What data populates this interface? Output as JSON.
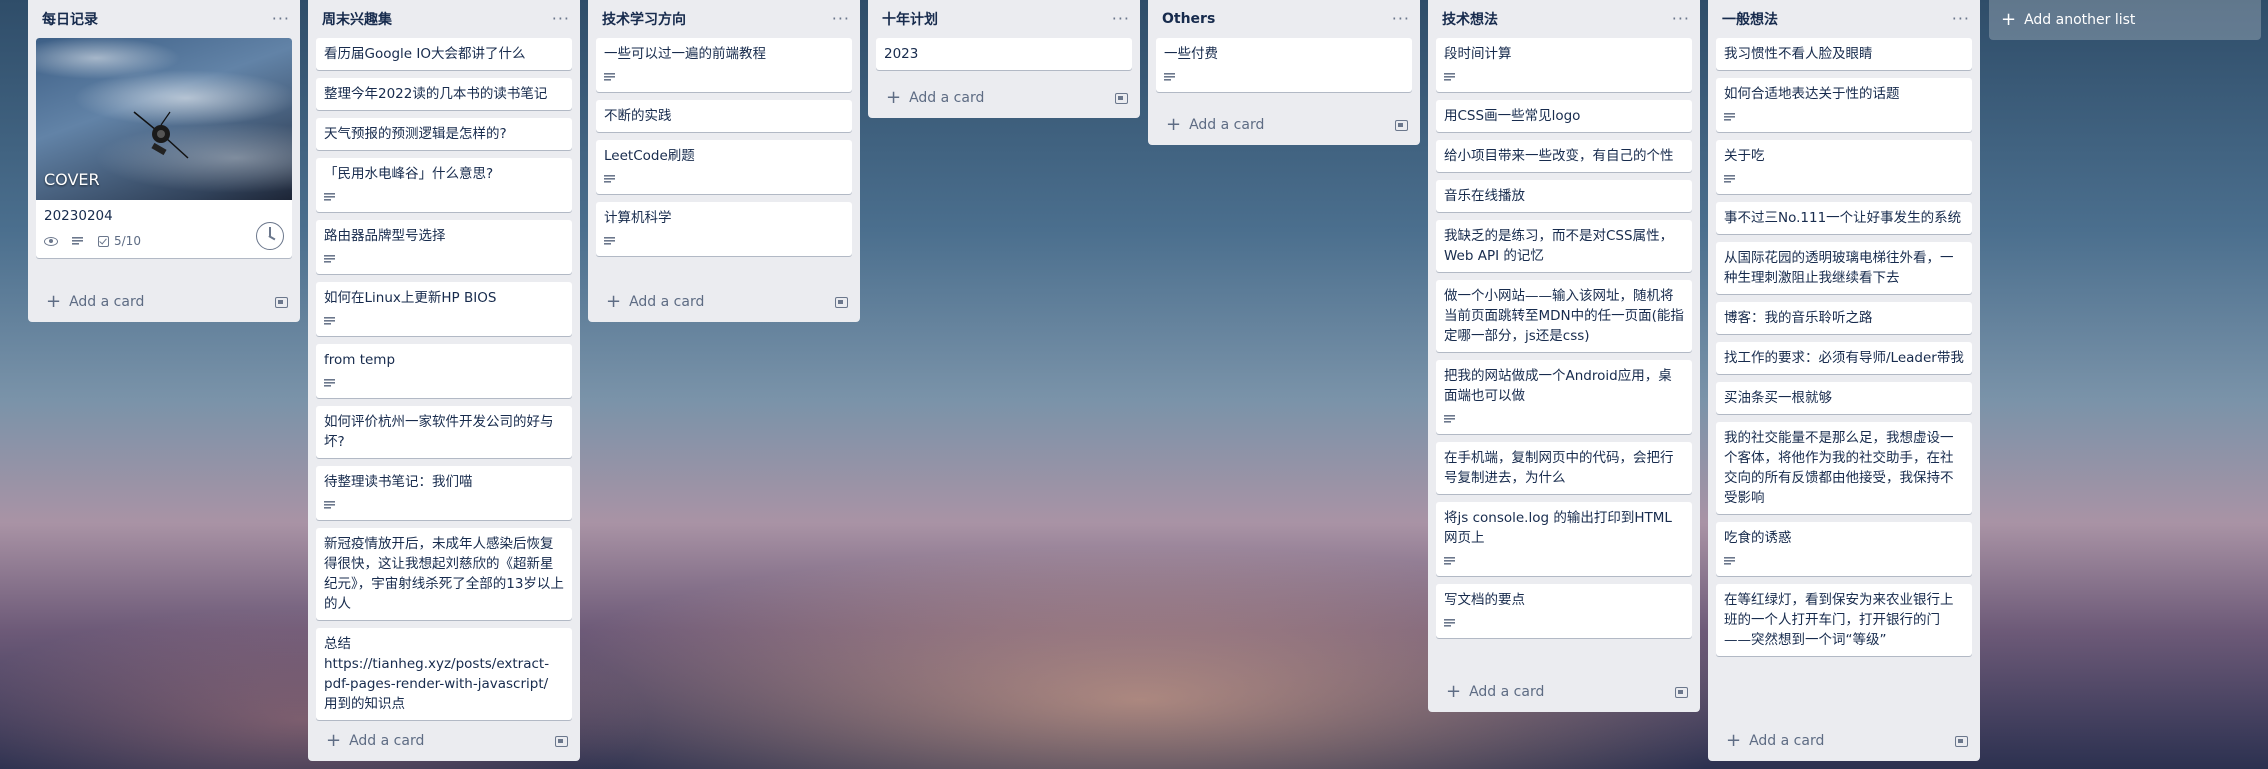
{
  "lists": [
    {
      "title": "每日记录",
      "cover_card": {
        "cover_text": "COVER",
        "title": "20230204",
        "checklist": "5/10"
      },
      "cards": [],
      "add_card": "Add a card"
    },
    {
      "title": "周末兴趣集",
      "cards": [
        {
          "title": "看历届Google IO大会都讲了什么",
          "desc": false
        },
        {
          "title": "整理今年2022读的几本书的读书笔记",
          "desc": false
        },
        {
          "title": "天气预报的预测逻辑是怎样的?",
          "desc": false
        },
        {
          "title": "「民用水电峰谷」什么意思?",
          "desc": true
        },
        {
          "title": "路由器品牌型号选择",
          "desc": true
        },
        {
          "title": "如何在Linux上更新HP BIOS",
          "desc": true
        },
        {
          "title": "from temp",
          "desc": true
        },
        {
          "title": "如何评价杭州一家软件开发公司的好与坏?",
          "desc": false
        },
        {
          "title": "待整理读书笔记：我们喵",
          "desc": true
        },
        {
          "title": "新冠疫情放开后，未成年人感染后恢复得很快，这让我想起刘慈欣的《超新星纪元》，宇宙射线杀死了全部的13岁以上的人",
          "desc": false
        },
        {
          "title": "总结 https://tianheg.xyz/posts/extract-pdf-pages-render-with-javascript/ 用到的知识点",
          "desc": false
        }
      ],
      "add_card": "Add a card"
    },
    {
      "title": "技术学习方向",
      "cards": [
        {
          "title": "一些可以过一遍的前端教程",
          "desc": true
        },
        {
          "title": "不断的实践",
          "desc": false
        },
        {
          "title": "LeetCode刷题",
          "desc": true
        },
        {
          "title": "计算机科学",
          "desc": true
        }
      ],
      "add_card": "Add a card"
    },
    {
      "title": "十年计划",
      "cards": [
        {
          "title": "2023",
          "desc": false
        }
      ],
      "add_card": "Add a card"
    },
    {
      "title": "Others",
      "cards": [
        {
          "title": "一些付费",
          "desc": true
        }
      ],
      "add_card": "Add a card"
    },
    {
      "title": "技术想法",
      "cards": [
        {
          "title": "段时间计算",
          "desc": true
        },
        {
          "title": "用CSS画一些常见logo",
          "desc": false
        },
        {
          "title": "给小项目带来一些改变，有自己的个性",
          "desc": false
        },
        {
          "title": "音乐在线播放",
          "desc": false
        },
        {
          "title": "我缺乏的是练习，而不是对CSS属性，Web API 的记忆",
          "desc": false
        },
        {
          "title": "做一个小网站——输入该网址，随机将当前页面跳转至MDN中的任一页面(能指定哪一部分，js还是css)",
          "desc": false
        },
        {
          "title": "把我的网站做成一个Android应用，桌面端也可以做",
          "desc": true
        },
        {
          "title": "在手机端，复制网页中的代码，会把行号复制进去，为什么",
          "desc": false
        },
        {
          "title": "将js console.log 的输出打印到HTML网页上",
          "desc": true
        },
        {
          "title": "写文档的要点",
          "desc": true
        }
      ],
      "add_card": "Add a card"
    },
    {
      "title": "一般想法",
      "cards": [
        {
          "title": "我习惯性不看人脸及眼睛",
          "desc": false
        },
        {
          "title": "如何合适地表达关于性的话题",
          "desc": true
        },
        {
          "title": "关于吃",
          "desc": true
        },
        {
          "title": "事不过三No.111一个让好事发生的系统",
          "desc": false
        },
        {
          "title": "从国际花园的透明玻璃电梯往外看，一种生理刺激阻止我继续看下去",
          "desc": false
        },
        {
          "title": "博客：我的音乐聆听之路",
          "desc": false
        },
        {
          "title": "找工作的要求：必须有导师/Leader带我",
          "desc": false
        },
        {
          "title": "买油条买一根就够",
          "desc": false
        },
        {
          "title": "我的社交能量不是那么足，我想虚设一个客体，将他作为我的社交助手，在社交向的所有反馈都由他接受，我保持不受影响",
          "desc": false
        },
        {
          "title": "吃食的诱惑",
          "desc": true
        },
        {
          "title": "在等红绿灯，看到保安为来农业银行上班的一个人打开车门，打开银行的门——突然想到一个词“等级”",
          "desc": false
        }
      ],
      "add_card": "Add a card"
    }
  ],
  "add_list": "Add another list"
}
